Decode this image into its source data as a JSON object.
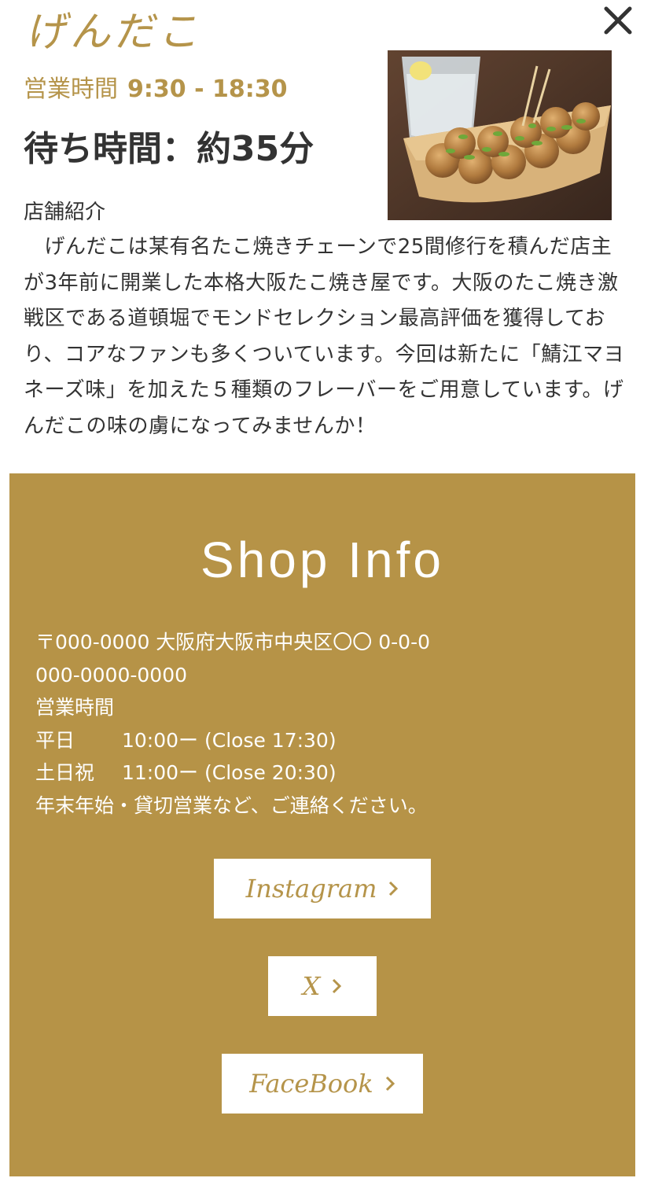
{
  "shop": {
    "name": "げんだこ",
    "hours_label": "営業時間",
    "hours_value": "9:30 - 18:30",
    "wait_time": "待ち時間：約35分",
    "intro_heading": "店舗紹介",
    "intro_text": "　げんだこは某有名たこ焼きチェーンで25間修行を積んだ店主が3年前に開業した本格大阪たこ焼き屋です。大阪のたこ焼き激戦区である道頓堀でモンドセレクション最高評価を獲得しており、コアなファンも多くついています。今回は新たに「鯖江マヨネーズ味」を加えた５種類のフレーバーをご用意しています。げんだこの味の虜になってみませんか！"
  },
  "shop_info": {
    "title": "Shop Info",
    "address": "〒000-0000 大阪府大阪市中央区〇〇 0-0-0",
    "phone": "000-0000-0000",
    "hours_label": "営業時間",
    "schedule": [
      {
        "day": "平日",
        "time": "10:00ー  (Close 17:30)"
      },
      {
        "day": "土日祝",
        "time": "11:00ー  (Close 20:30)"
      }
    ],
    "note": "年末年始・貸切営業など、ご連絡ください。"
  },
  "social": {
    "instagram_label": "Instagram",
    "x_label": "X",
    "facebook_label": "FaceBook"
  },
  "icons": {
    "close": "close-icon",
    "chevron": "chevron-right-icon"
  },
  "colors": {
    "accent": "#b5944a",
    "panel": "#b69347",
    "text": "#333333",
    "white": "#ffffff"
  }
}
